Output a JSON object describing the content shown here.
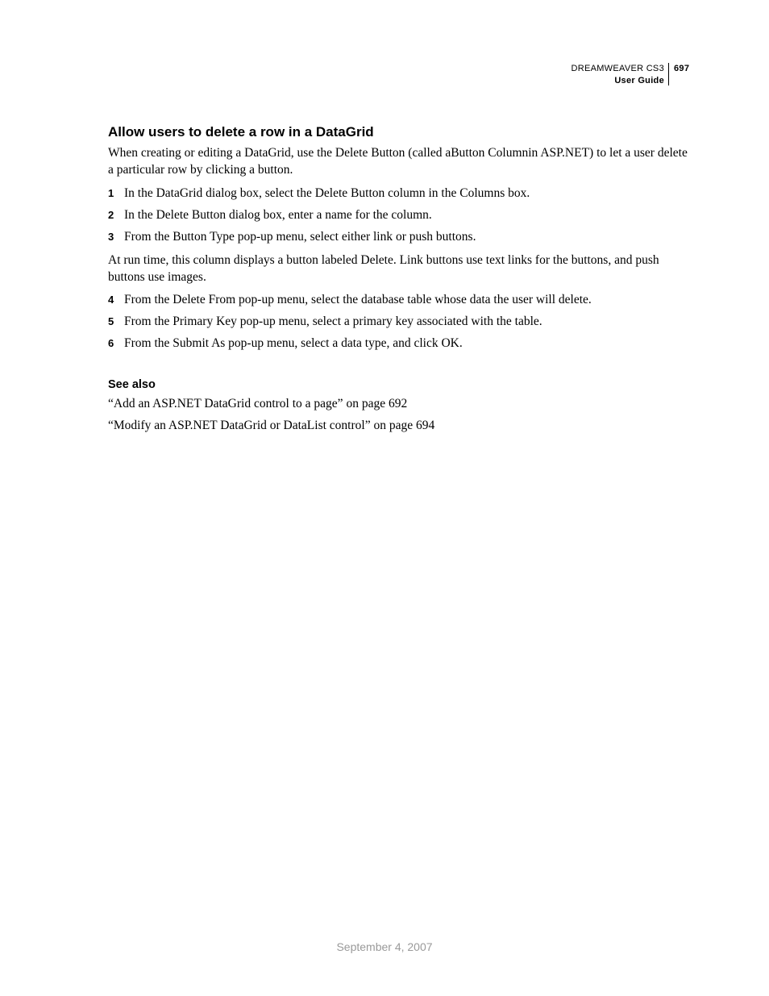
{
  "header": {
    "product": "DREAMWEAVER CS3",
    "page_number": "697",
    "guide": "User Guide"
  },
  "section": {
    "title": "Allow users to delete a row in a DataGrid",
    "intro": "When creating or editing a DataGrid, use the Delete Button (called aButton Columnin ASP.NET) to let a user delete a particular row by clicking a button.",
    "steps_a": [
      "In the DataGrid dialog box, select the Delete Button column in the Columns box.",
      "In the Delete Button dialog box, enter a name for the column.",
      "From the Button Type pop-up menu, select either link or push buttons."
    ],
    "mid_text": "At run time, this column displays a button labeled Delete. Link buttons use text links for the buttons, and push buttons use images.",
    "steps_b": [
      "From the Delete From pop-up menu, select the database table whose data the user will delete.",
      "From the Primary Key pop-up menu, select a primary key associated with the table.",
      "From the Submit As pop-up menu, select a data type, and click OK."
    ]
  },
  "see_also": {
    "title": "See also",
    "items": [
      "“Add an ASP.NET DataGrid control to a page” on page 692",
      "“Modify an ASP.NET DataGrid or DataList control” on page 694"
    ]
  },
  "footer": {
    "date": "September 4, 2007"
  },
  "step_numbers": {
    "n1": "1",
    "n2": "2",
    "n3": "3",
    "n4": "4",
    "n5": "5",
    "n6": "6"
  }
}
